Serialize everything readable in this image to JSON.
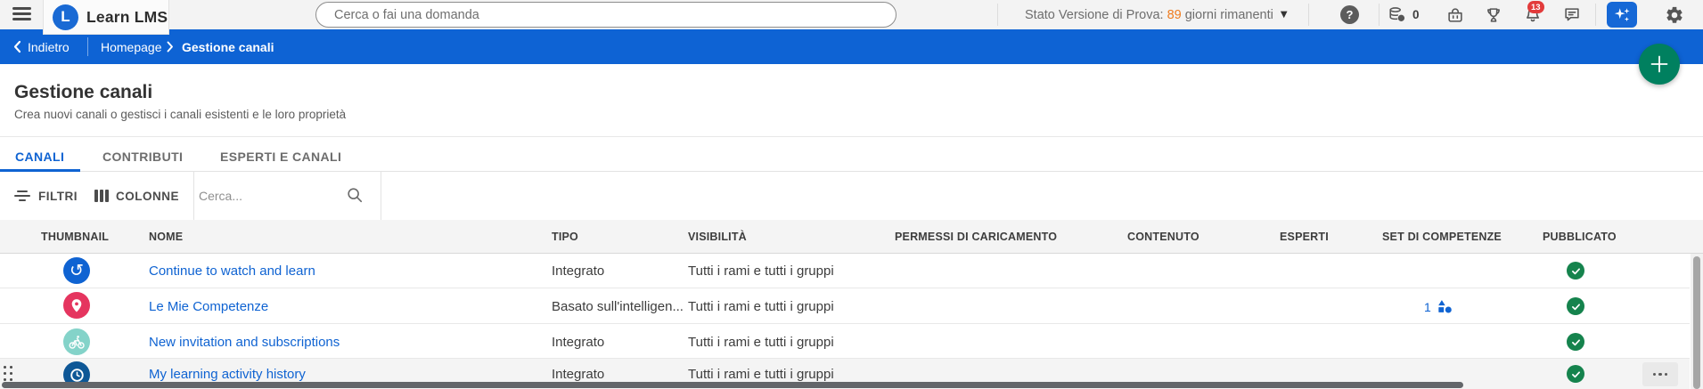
{
  "header": {
    "logo_letter": "L",
    "logo_text": "Learn LMS",
    "search_placeholder": "Cerca o fai una domanda",
    "trial": {
      "label": "Stato Versione di Prova:",
      "days": "89",
      "suffix": "giorni rimanenti"
    },
    "help_label": "?",
    "coins_count": "0",
    "notification_count": "13"
  },
  "breadcrumb": {
    "back": "Indietro",
    "home": "Homepage",
    "current": "Gestione canali"
  },
  "page": {
    "title": "Gestione canali",
    "subtitle": "Crea nuovi canali o gestisci i canali esistenti e le loro proprietà"
  },
  "tabs": [
    {
      "label": "CANALI",
      "active": true
    },
    {
      "label": "CONTRIBUTI",
      "active": false
    },
    {
      "label": "ESPERTI E CANALI",
      "active": false
    }
  ],
  "toolbar": {
    "filters_label": "FILTRI",
    "columns_label": "COLONNE",
    "search_placeholder": "Cerca..."
  },
  "table": {
    "headers": [
      "THUMBNAIL",
      "NOME",
      "TIPO",
      "VISIBILITÀ",
      "PERMESSI DI CARICAMENTO",
      "CONTENUTO",
      "ESPERTI",
      "SET DI COMPETENZE",
      "PUBBLICATO"
    ],
    "rows": [
      {
        "name": "Continue to watch and learn",
        "type": "Integrato",
        "visibility": "Tutti i rami e tutti i gruppi",
        "icon": "history-icon",
        "icon_glyph": "↺",
        "icon_color": "#0f63d2",
        "competence_sets": "",
        "published": true
      },
      {
        "name": "Le Mie Competenze",
        "type": "Basato sull'intelligen...",
        "visibility": "Tutti i rami e tutti i gruppi",
        "icon": "pin-icon",
        "icon_color": "#e5355f",
        "competence_sets": "1",
        "published": true
      },
      {
        "name": "New invitation and subscriptions",
        "type": "Integrato",
        "visibility": "Tutti i rami e tutti i gruppi",
        "icon": "bike-icon",
        "icon_color": "#84d3c9",
        "competence_sets": "",
        "published": true
      },
      {
        "name": "My learning activity history",
        "type": "Integrato",
        "visibility": "Tutti i rami e tutti i gruppi",
        "icon": "clock-icon",
        "icon_color": "#0e5796",
        "competence_sets": "",
        "published": true
      }
    ]
  },
  "colors": {
    "topbar_bg": "#f3f3f3",
    "accent_blue": "#0f63d2",
    "breadcrumb_blue": "#0e63d4",
    "fab_green": "#00805f",
    "check_green": "#15834d",
    "badge_red": "#e23b3b",
    "trial_days_orange": "#ef7b1d"
  }
}
